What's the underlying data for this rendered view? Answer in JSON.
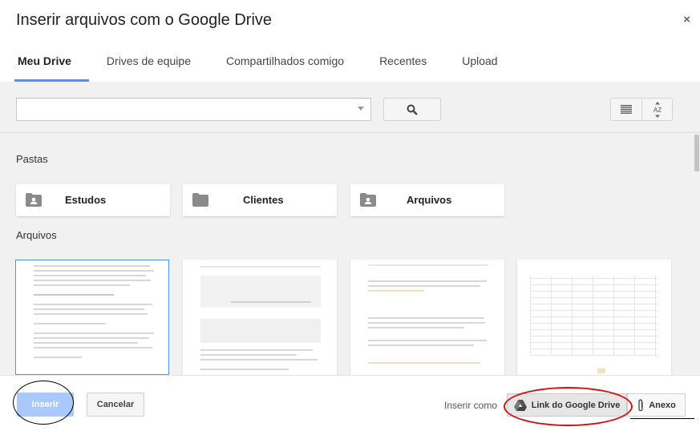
{
  "dialog": {
    "title": "Inserir arquivos com o Google Drive",
    "close_symbol": "×"
  },
  "tabs": [
    {
      "label": "Meu Drive",
      "active": true
    },
    {
      "label": "Drives de equipe",
      "active": false
    },
    {
      "label": "Compartilhados comigo",
      "active": false
    },
    {
      "label": "Recentes",
      "active": false
    },
    {
      "label": "Upload",
      "active": false
    }
  ],
  "search": {
    "value": "",
    "icons": [
      "dropdown-arrow-icon",
      "search-icon"
    ]
  },
  "view_controls": {
    "icons": [
      "list-view-icon",
      "sort-az-icon"
    ],
    "sort_label": "AZ"
  },
  "sections": {
    "folders_label": "Pastas",
    "files_label": "Arquivos"
  },
  "folders": [
    {
      "name": "Estudos",
      "icon": "shared-folder-icon"
    },
    {
      "name": "Clientes",
      "icon": "folder-icon"
    },
    {
      "name": "Arquivos",
      "icon": "shared-folder-icon"
    }
  ],
  "files": [
    {
      "kind": "document",
      "selected": true
    },
    {
      "kind": "document",
      "selected": false
    },
    {
      "kind": "document",
      "selected": false
    },
    {
      "kind": "spreadsheet",
      "selected": false
    }
  ],
  "footer": {
    "insert_label": "Inserir",
    "cancel_label": "Cancelar",
    "insert_as_label": "Inserir como",
    "drive_link_label": "Link do Google Drive",
    "attachment_label": "Anexo"
  },
  "colors": {
    "accent": "#4d90fe",
    "insert_button": "#a9c9fd",
    "annotation_red": "#d01010",
    "annotation_black": "#000000"
  }
}
